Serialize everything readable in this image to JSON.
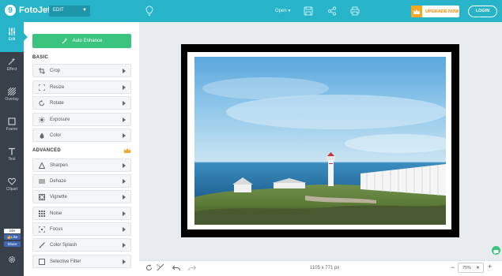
{
  "app": {
    "logo_letter": "9",
    "name": "FotoJet"
  },
  "header": {
    "mode": "EDIT",
    "open_label": "Open",
    "upgrade_label": "UPGRADE NOW",
    "login_label": "LOGIN"
  },
  "rail": {
    "items": [
      {
        "label": "Edit",
        "icon": "sliders-icon",
        "active": true
      },
      {
        "label": "Effect",
        "icon": "magic-wand-icon",
        "active": false
      },
      {
        "label": "Overlay",
        "icon": "overlay-icon",
        "active": false
      },
      {
        "label": "Frame",
        "icon": "frame-icon",
        "active": false
      },
      {
        "label": "Text",
        "icon": "text-icon",
        "active": false
      },
      {
        "label": "Clipart",
        "icon": "heart-icon",
        "active": false
      }
    ],
    "like_count": "24K",
    "like_label": "Like",
    "share_label": "Share"
  },
  "panel": {
    "auto_enhance_label": "Auto Enhance",
    "basic_title": "BASIC",
    "basic_tools": [
      {
        "label": "Crop",
        "icon": "crop-icon"
      },
      {
        "label": "Resize",
        "icon": "resize-icon"
      },
      {
        "label": "Rotate",
        "icon": "rotate-icon"
      },
      {
        "label": "Exposure",
        "icon": "exposure-icon"
      },
      {
        "label": "Color",
        "icon": "color-drop-icon"
      }
    ],
    "advanced_title": "ADVANCED",
    "advanced_tools": [
      {
        "label": "Sharpen",
        "icon": "sharpen-icon"
      },
      {
        "label": "Dehaze",
        "icon": "dehaze-icon"
      },
      {
        "label": "Vignette",
        "icon": "vignette-icon"
      },
      {
        "label": "Noise",
        "icon": "noise-icon"
      },
      {
        "label": "Focus",
        "icon": "focus-icon"
      },
      {
        "label": "Color Splash",
        "icon": "brush-icon"
      },
      {
        "label": "Selective Filter",
        "icon": "filter-icon"
      }
    ]
  },
  "canvas": {
    "dimensions": "1105 x 771 px",
    "zoom": "75%",
    "zoom_minus": "−",
    "zoom_plus": "+"
  },
  "colors": {
    "accent": "#27b4c9",
    "rail_bg": "#3a4049",
    "auto_enhance": "#3ac47d",
    "upgrade": "#f5a623"
  }
}
